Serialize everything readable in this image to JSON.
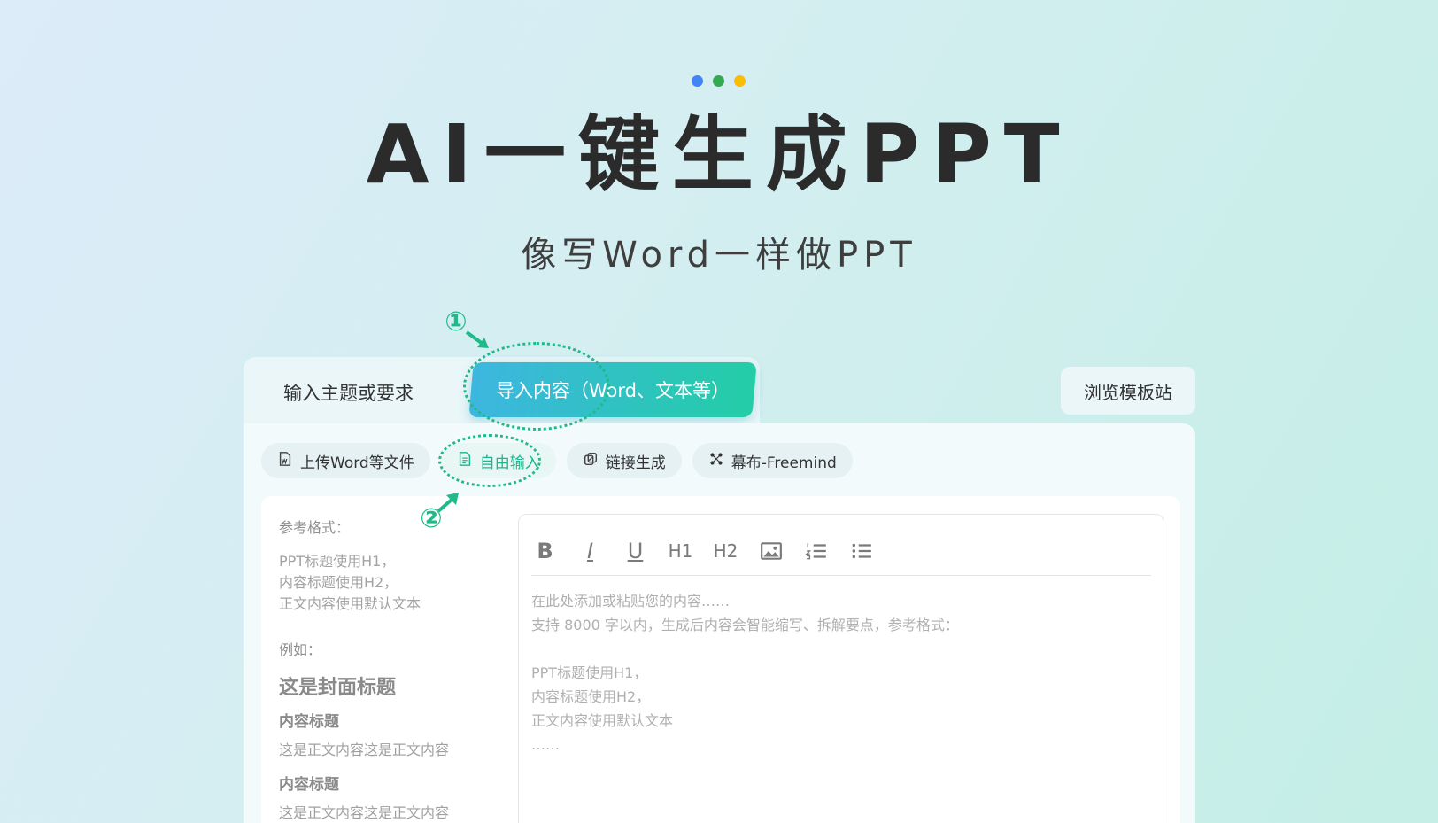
{
  "hero": {
    "title": "AI一键生成PPT",
    "subtitle": "像写Word一样做PPT",
    "dots": [
      {
        "name": "blue",
        "color": "#3f86f4"
      },
      {
        "name": "green",
        "color": "#34a853"
      },
      {
        "name": "yellow",
        "color": "#fbbc05"
      }
    ]
  },
  "tabs": {
    "topic": "输入主题或要求",
    "import": "导入内容（Word、文本等）",
    "browse": "浏览模板站"
  },
  "subtabs": [
    {
      "label": "上传Word等文件",
      "icon": "word-file-icon"
    },
    {
      "label": "自由输入",
      "icon": "document-icon"
    },
    {
      "label": "链接生成",
      "icon": "link-icon"
    },
    {
      "label": "幕布-Freemind",
      "icon": "mindmap-icon"
    }
  ],
  "reference": {
    "format_heading": "参考格式：",
    "format_lines": [
      "PPT标题使用H1，",
      "内容标题使用H2，",
      "正文内容使用默认文本"
    ],
    "example_heading": "例如：",
    "example_title": "这是封面标题",
    "example_h2_a": "内容标题",
    "example_body_a": "这是正文内容这是正文内容",
    "example_h2_b": "内容标题",
    "example_body_b": "这是正文内容这是正文内容"
  },
  "editor": {
    "toolbar": [
      "bold-icon",
      "italic-icon",
      "underline-icon",
      "heading1-icon",
      "heading2-icon",
      "image-icon",
      "ordered-list-icon",
      "bullet-list-icon"
    ],
    "toolbar_labels": {
      "bold": "B",
      "italic": "I",
      "underline": "U",
      "h1": "H1",
      "h2": "H2"
    },
    "placeholder": "在此处添加或粘贴您的内容……\n支持 8000 字以内，生成后内容会智能缩写、拆解要点，参考格式：\n\nPPT标题使用H1，\n内容标题使用H2，\n正文内容使用默认文本\n……"
  },
  "annotations": {
    "step1": "①",
    "step2": "②",
    "color": "#1fb98a"
  }
}
